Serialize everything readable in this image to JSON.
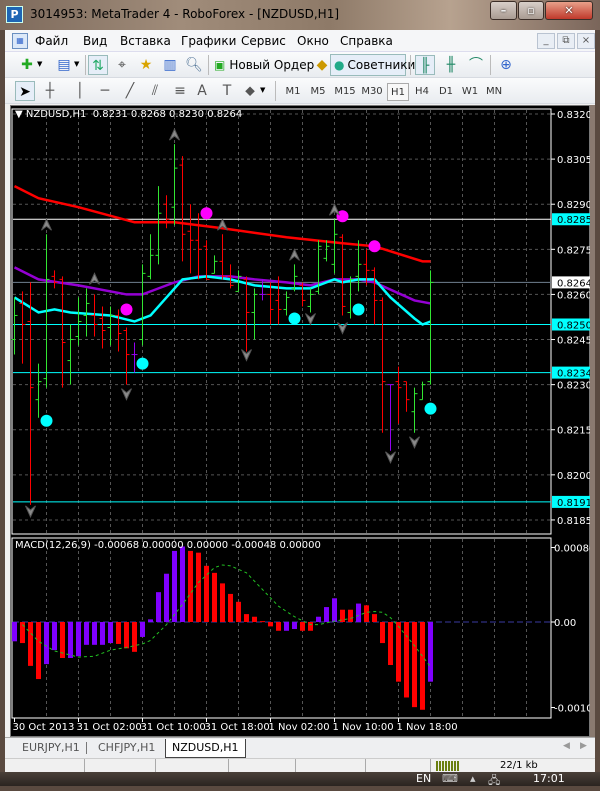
{
  "window": {
    "title": "3014953: MetaTrader 4 - RoboForex - [NZDUSD,H1]",
    "minimize": "–",
    "maximize": "▫",
    "close": "✕"
  },
  "menu": [
    "Файл",
    "Вид",
    "Вставка",
    "Графики",
    "Сервис",
    "Окно",
    "Справка"
  ],
  "mdi": {
    "minimize": "_",
    "restore": "⧉",
    "close": "×"
  },
  "toolbar": {
    "new_order": "Новый Ордер",
    "experts": "Советники"
  },
  "timeframes": [
    "M1",
    "M5",
    "M15",
    "M30",
    "H1",
    "H4",
    "D1",
    "W1",
    "MN"
  ],
  "active_timeframe": "H1",
  "chart": {
    "header": "NZDUSD,H1  0.8231 0.8268 0.8230 0.8264",
    "macd_header": "MACD(12,26,9) -0.00068 0.00000 0.00000 -0.00048 0.00000"
  },
  "tabs": [
    "EURJPY,H1",
    "CHFJPY,H1",
    "NZDUSD,H1"
  ],
  "active_tab": "NZDUSD,H1",
  "status": {
    "traffic": "22/1 kb"
  },
  "taskbar": {
    "lang": "EN",
    "clock": "17:01"
  },
  "colors": {
    "up": "#32e632",
    "down": "#ff0000",
    "doji": "#9400f0",
    "ma_slow": "#ff0000",
    "ma_mid": "#9400d3",
    "ma_fast": "#00ffff",
    "dot_up": "#ff00ff",
    "dot_down": "#00ffff",
    "macd_up": "#8000ff",
    "macd_down": "#ff0000",
    "signal": "#22c022"
  },
  "chart_data": [
    {
      "type": "ohlc",
      "title": "NZDUSD,H1",
      "ylim": [
        0.8182,
        0.832
      ],
      "yticks": [
        "0.8320",
        "0.8305",
        "0.8290",
        "0.8275",
        "0.8260",
        "0.8245",
        "0.8230",
        "0.8215",
        "0.8200",
        "0.8185"
      ],
      "xticks": [
        {
          "bar": 0,
          "label": "30 Oct 2013"
        },
        {
          "bar": 8,
          "label": "31 Oct 02:00"
        },
        {
          "bar": 16,
          "label": "31 Oct 10:00"
        },
        {
          "bar": 24,
          "label": "31 Oct 18:00"
        },
        {
          "bar": 32,
          "label": "1 Nov 02:00"
        },
        {
          "bar": 40,
          "label": "1 Nov 10:00"
        },
        {
          "bar": 48,
          "label": "1 Nov 18:00"
        }
      ],
      "ohlc": [
        [
          0.8245,
          0.8259,
          0.824,
          0.8253
        ],
        [
          0.8257,
          0.8261,
          0.8237,
          0.825
        ],
        [
          0.8251,
          0.8264,
          0.819,
          0.8229
        ],
        [
          0.8225,
          0.8237,
          0.8219,
          0.8231
        ],
        [
          0.8232,
          0.828,
          0.8229,
          0.8265
        ],
        [
          0.8266,
          0.8268,
          0.8262,
          0.8264
        ],
        [
          0.8265,
          0.8266,
          0.8229,
          0.8244
        ],
        [
          0.8238,
          0.825,
          0.823,
          0.8245
        ],
        [
          0.8246,
          0.8259,
          0.8243,
          0.8251
        ],
        [
          0.8253,
          0.8262,
          0.8246,
          0.8257
        ],
        [
          0.8253,
          0.826,
          0.8246,
          0.825
        ],
        [
          0.8252,
          0.8256,
          0.8242,
          0.8248
        ],
        [
          0.8249,
          0.8256,
          0.8243,
          0.8253
        ],
        [
          0.8253,
          0.8255,
          0.8241,
          0.8247
        ],
        [
          0.8248,
          0.8249,
          0.823,
          0.824
        ],
        [
          0.824,
          0.8244,
          0.8234,
          0.824
        ],
        [
          0.8245,
          0.827,
          0.8243,
          0.8267
        ],
        [
          0.8266,
          0.828,
          0.8265,
          0.8273
        ],
        [
          0.8273,
          0.8296,
          0.827,
          0.8287
        ],
        [
          0.829,
          0.8293,
          0.8282,
          0.8285
        ],
        [
          0.8289,
          0.831,
          0.8283,
          0.8302
        ],
        [
          0.8303,
          0.8306,
          0.8271,
          0.828
        ],
        [
          0.8281,
          0.829,
          0.8267,
          0.8278
        ],
        [
          0.8278,
          0.8287,
          0.8265,
          0.8275
        ],
        [
          0.8276,
          0.8278,
          0.8265,
          0.8265
        ],
        [
          0.8267,
          0.8273,
          0.8267,
          0.8271
        ],
        [
          0.8271,
          0.828,
          0.8265,
          0.8266
        ],
        [
          0.8266,
          0.827,
          0.8262,
          0.8263
        ],
        [
          0.8261,
          0.8268,
          0.8261,
          0.8266
        ],
        [
          0.8265,
          0.8266,
          0.8241,
          0.8254
        ],
        [
          0.8254,
          0.8262,
          0.8245,
          0.826
        ],
        [
          0.826,
          0.8265,
          0.8258,
          0.826
        ],
        [
          0.826,
          0.8264,
          0.825,
          0.8255
        ],
        [
          0.8258,
          0.8266,
          0.825,
          0.8255
        ],
        [
          0.8255,
          0.8261,
          0.8253,
          0.8259
        ],
        [
          0.8262,
          0.827,
          0.8261,
          0.8266
        ],
        [
          0.8263,
          0.8264,
          0.8256,
          0.8258
        ],
        [
          0.8256,
          0.8262,
          0.8254,
          0.826
        ],
        [
          0.8261,
          0.8278,
          0.826,
          0.8276
        ],
        [
          0.8272,
          0.8278,
          0.8271,
          0.8276
        ],
        [
          0.827,
          0.8285,
          0.8267,
          0.828
        ],
        [
          0.8279,
          0.828,
          0.8253,
          0.8256
        ],
        [
          0.8254,
          0.8266,
          0.8252,
          0.8265
        ],
        [
          0.8266,
          0.8278,
          0.8261,
          0.827
        ],
        [
          0.827,
          0.8275,
          0.8263,
          0.8268
        ],
        [
          0.8268,
          0.8269,
          0.825,
          0.8258
        ],
        [
          0.8258,
          0.8259,
          0.8214,
          0.8231
        ],
        [
          0.823,
          0.823,
          0.8208,
          0.823
        ],
        [
          0.8231,
          0.8236,
          0.8217,
          0.8229
        ],
        [
          0.8231,
          0.8231,
          0.8221,
          0.8225
        ],
        [
          0.8221,
          0.8229,
          0.8214,
          0.8227
        ],
        [
          0.8225,
          0.8231,
          0.8225,
          0.823
        ],
        [
          0.8231,
          0.8268,
          0.823,
          0.8264
        ]
      ],
      "lines": [
        {
          "name": "ma-slow",
          "color": "#ff0000",
          "points": [
            [
              0,
              0.8296
            ],
            [
              3,
              0.8292
            ],
            [
              8,
              0.8289
            ],
            [
              15,
              0.8284
            ],
            [
              20,
              0.8284
            ],
            [
              26,
              0.8282
            ],
            [
              34,
              0.8279
            ],
            [
              41,
              0.8277
            ],
            [
              45,
              0.8276
            ],
            [
              51,
              0.8271
            ],
            [
              52,
              0.8271
            ]
          ]
        },
        {
          "name": "ma-mid",
          "color": "#9400d3",
          "points": [
            [
              0,
              0.8269
            ],
            [
              3,
              0.8265
            ],
            [
              8,
              0.8263
            ],
            [
              14,
              0.826
            ],
            [
              16,
              0.826
            ],
            [
              20,
              0.8264
            ],
            [
              23,
              0.8266
            ],
            [
              27,
              0.8266
            ],
            [
              30,
              0.8265
            ],
            [
              34,
              0.8264
            ],
            [
              37,
              0.8263
            ],
            [
              40,
              0.8265
            ],
            [
              43,
              0.8265
            ],
            [
              45,
              0.8264
            ],
            [
              50,
              0.8258
            ],
            [
              52,
              0.8257
            ]
          ]
        },
        {
          "name": "ma-fast",
          "color": "#00ffff",
          "points": [
            [
              0,
              0.8259
            ],
            [
              3,
              0.8254
            ],
            [
              5,
              0.8255
            ],
            [
              7,
              0.8254
            ],
            [
              12,
              0.8253
            ],
            [
              15,
              0.8251
            ],
            [
              17,
              0.8253
            ],
            [
              19,
              0.8259
            ],
            [
              21,
              0.8265
            ],
            [
              24,
              0.8266
            ],
            [
              27,
              0.8265
            ],
            [
              30,
              0.8263
            ],
            [
              34,
              0.8262
            ],
            [
              37,
              0.8262
            ],
            [
              40,
              0.8265
            ],
            [
              41,
              0.8264
            ],
            [
              43,
              0.8265
            ],
            [
              45,
              0.8265
            ],
            [
              47,
              0.8259
            ],
            [
              50,
              0.8252
            ],
            [
              51,
              0.825
            ],
            [
              52,
              0.8251
            ]
          ]
        }
      ],
      "hlines": [
        {
          "price": "0.8285",
          "color": "#ffffff",
          "label_bg": "#00ffff"
        },
        {
          "price": "0.8264",
          "color": "#708090",
          "label_bg": "#ffffff"
        },
        {
          "price": "0.8250",
          "color": "#00ffff",
          "label_bg": "#00ffff"
        },
        {
          "price": "0.8234",
          "color": "#00ffff",
          "label_bg": "#00ffff"
        },
        {
          "price": "0.8191",
          "color": "#00ffff",
          "label_bg": "#00ffff"
        }
      ],
      "dots": [
        {
          "bar": 14,
          "price": 0.8255,
          "kind": "magenta"
        },
        {
          "bar": 24,
          "price": 0.8287,
          "kind": "magenta"
        },
        {
          "bar": 41,
          "price": 0.8286,
          "kind": "magenta"
        },
        {
          "bar": 45,
          "price": 0.8276,
          "kind": "magenta"
        },
        {
          "bar": 4,
          "price": 0.8218,
          "kind": "cyan"
        },
        {
          "bar": 16,
          "price": 0.8237,
          "kind": "cyan"
        },
        {
          "bar": 35,
          "price": 0.8252,
          "kind": "cyan"
        },
        {
          "bar": 43,
          "price": 0.8255,
          "kind": "cyan"
        },
        {
          "bar": 52,
          "price": 0.8222,
          "kind": "cyan"
        }
      ],
      "arrows": [
        {
          "bar": 4,
          "price": 0.8283,
          "dir": "up"
        },
        {
          "bar": 10,
          "price": 0.8265,
          "dir": "up"
        },
        {
          "bar": 20,
          "price": 0.8313,
          "dir": "up"
        },
        {
          "bar": 26,
          "price": 0.8283,
          "dir": "up"
        },
        {
          "bar": 35,
          "price": 0.8273,
          "dir": "up"
        },
        {
          "bar": 40,
          "price": 0.8288,
          "dir": "up"
        },
        {
          "bar": 2,
          "price": 0.8188,
          "dir": "down"
        },
        {
          "bar": 14,
          "price": 0.8227,
          "dir": "down"
        },
        {
          "bar": 29,
          "price": 0.824,
          "dir": "down"
        },
        {
          "bar": 37,
          "price": 0.8252,
          "dir": "down"
        },
        {
          "bar": 41,
          "price": 0.8249,
          "dir": "down"
        },
        {
          "bar": 47,
          "price": 0.8206,
          "dir": "down"
        },
        {
          "bar": 50,
          "price": 0.8211,
          "dir": "down"
        }
      ]
    },
    {
      "type": "bar",
      "title": "MACD(12,26,9)",
      "ylim": [
        -0.00102,
        0.00086
      ],
      "yticks": [
        "0.00086",
        "0.00",
        "-0.00102"
      ],
      "histogram": [
        -0.00022,
        -0.00024,
        -0.0005,
        -0.00065,
        -0.00048,
        -0.00032,
        -0.00041,
        -0.00041,
        -0.00039,
        -0.00026,
        -0.00026,
        -0.00026,
        -0.00024,
        -0.00025,
        -0.0003,
        -0.00034,
        -0.00017,
        3e-05,
        0.00034,
        0.00055,
        0.00081,
        0.00086,
        0.00081,
        0.00079,
        0.00064,
        0.00056,
        0.00044,
        0.00032,
        0.00023,
        9e-05,
        6e-05,
        1e-05,
        -5e-05,
        -0.0001,
        -0.0001,
        -8e-05,
        -0.0001,
        -0.0001,
        6e-05,
        0.00017,
        0.00027,
        0.00014,
        0.00014,
        0.00021,
        0.00019,
        9e-05,
        -0.00024,
        -0.00049,
        -0.00068,
        -0.00086,
        -0.00097,
        -0.001,
        -0.00068
      ],
      "histogram_colors": [
        "p",
        "r",
        "r",
        "r",
        "p",
        "p",
        "r",
        "p",
        "p",
        "p",
        "p",
        "p",
        "p",
        "r",
        "r",
        "r",
        "p",
        "p",
        "p",
        "p",
        "p",
        "p",
        "r",
        "r",
        "r",
        "r",
        "r",
        "r",
        "r",
        "r",
        "r",
        "r",
        "r",
        "r",
        "p",
        "p",
        "r",
        "r",
        "p",
        "p",
        "p",
        "r",
        "r",
        "p",
        "r",
        "r",
        "r",
        "r",
        "r",
        "r",
        "r",
        "r",
        "p"
      ],
      "signal": [
        [
          1,
          -3e-05
        ],
        [
          3,
          -0.00022
        ],
        [
          5,
          -0.00033
        ],
        [
          8,
          -0.0004
        ],
        [
          10,
          -0.00039
        ],
        [
          12,
          -0.00032
        ],
        [
          14,
          -0.00029
        ],
        [
          16,
          -0.00025
        ],
        [
          17,
          -0.00021
        ],
        [
          19,
          -3e-05
        ],
        [
          21,
          0.0002
        ],
        [
          23,
          0.00045
        ],
        [
          25,
          0.00062
        ],
        [
          26,
          0.00065
        ],
        [
          27,
          0.00064
        ],
        [
          28,
          0.0006
        ],
        [
          29,
          0.00056
        ],
        [
          31,
          0.00037
        ],
        [
          33,
          0.00018
        ],
        [
          35,
          6e-05
        ],
        [
          37,
          -3e-05
        ],
        [
          38,
          -3e-05
        ],
        [
          40,
          1e-05
        ],
        [
          42,
          4e-05
        ],
        [
          44,
          0.00011
        ],
        [
          45,
          0.00012
        ],
        [
          46,
          0.00011
        ],
        [
          47,
          5e-05
        ],
        [
          48,
          -5e-05
        ],
        [
          50,
          -0.00027
        ],
        [
          52,
          -0.00051
        ]
      ]
    }
  ]
}
